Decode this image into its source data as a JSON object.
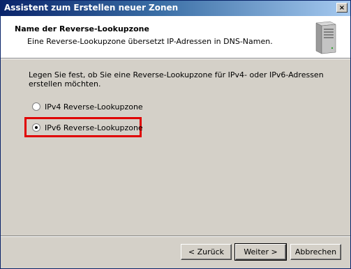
{
  "window": {
    "title": "Assistent zum Erstellen neuer Zonen",
    "close_glyph": "×"
  },
  "header": {
    "title": "Name der Reverse-Lookupzone",
    "subtitle": "Eine Reverse-Lookupzone übersetzt IP-Adressen in DNS-Namen.",
    "icon": "server-icon"
  },
  "content": {
    "intro": "Legen Sie fest, ob Sie eine Reverse-Lookupzone für IPv4- oder IPv6-Adressen erstellen möchten.",
    "options": [
      {
        "label": "IPv4 Reverse-Lookupzone",
        "selected": false
      },
      {
        "label": "IPv6 Reverse-Lookupzone",
        "selected": true
      }
    ],
    "highlight_color": "#e00000"
  },
  "buttons": {
    "back": "< Zurück",
    "next": "Weiter >",
    "cancel": "Abbrechen"
  }
}
